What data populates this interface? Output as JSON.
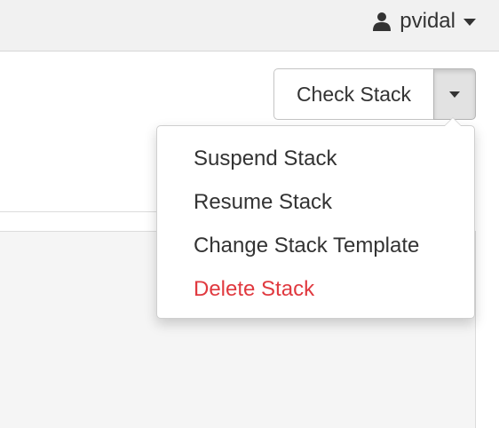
{
  "navbar": {
    "user_name": "pvidal",
    "user_icon": "user-icon",
    "caret_icon": "caret-down-icon"
  },
  "actions": {
    "primary_label": "Check Stack",
    "toggle_icon": "caret-down-icon"
  },
  "dropdown": {
    "items": [
      {
        "label": "Suspend Stack",
        "style": "normal"
      },
      {
        "label": "Resume Stack",
        "style": "normal"
      },
      {
        "label": "Change Stack Template",
        "style": "normal"
      },
      {
        "label": "Delete Stack",
        "style": "danger"
      }
    ]
  },
  "colors": {
    "danger": "#e0393f",
    "text": "#333333",
    "navbar_bg": "#f1f1f1"
  }
}
